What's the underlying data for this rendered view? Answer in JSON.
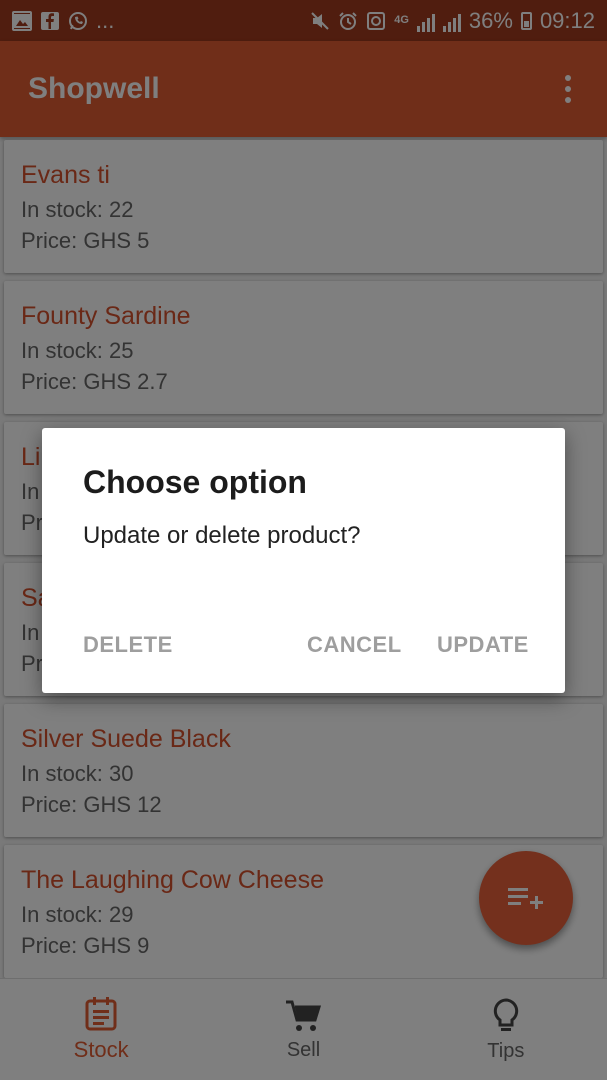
{
  "status_bar": {
    "left_icons": [
      "image-icon",
      "facebook-icon",
      "whatsapp-icon"
    ],
    "more": "...",
    "network": "4G",
    "battery": "36%",
    "time": "09:12"
  },
  "app_bar": {
    "title": "Shopwell",
    "menu_icon": "more-vert-icon"
  },
  "products": [
    {
      "name": "Evans ti",
      "stock": "In stock:  22",
      "price": "Price:  GHS 5"
    },
    {
      "name": "Founty Sardine",
      "stock": "In stock:  25",
      "price": "Price:  GHS 2.7"
    },
    {
      "name": "Li",
      "stock": "In",
      "price": "Pr"
    },
    {
      "name": "Sa",
      "stock": "In",
      "price": "Pr"
    },
    {
      "name": "Silver Suede Black",
      "stock": "In stock:  30",
      "price": "Price:  GHS 12"
    },
    {
      "name": "The Laughing Cow Cheese",
      "stock": "In stock:  29",
      "price": "Price:  GHS 9"
    }
  ],
  "fab": {
    "icon": "playlist-add-icon"
  },
  "bottom_nav": {
    "items": [
      {
        "label": "Stock",
        "icon": "list-icon",
        "active": true
      },
      {
        "label": "Sell",
        "icon": "cart-icon",
        "active": false
      },
      {
        "label": "Tips",
        "icon": "lightbulb-icon",
        "active": false
      }
    ]
  },
  "dialog": {
    "title": "Choose option",
    "message": "Update or delete product?",
    "delete_label": "DELETE",
    "cancel_label": "CANCEL",
    "update_label": "UPDATE"
  },
  "colors": {
    "primary": "#e05c32",
    "status_bar": "#a03a1e",
    "accent_text": "#d4502c"
  }
}
